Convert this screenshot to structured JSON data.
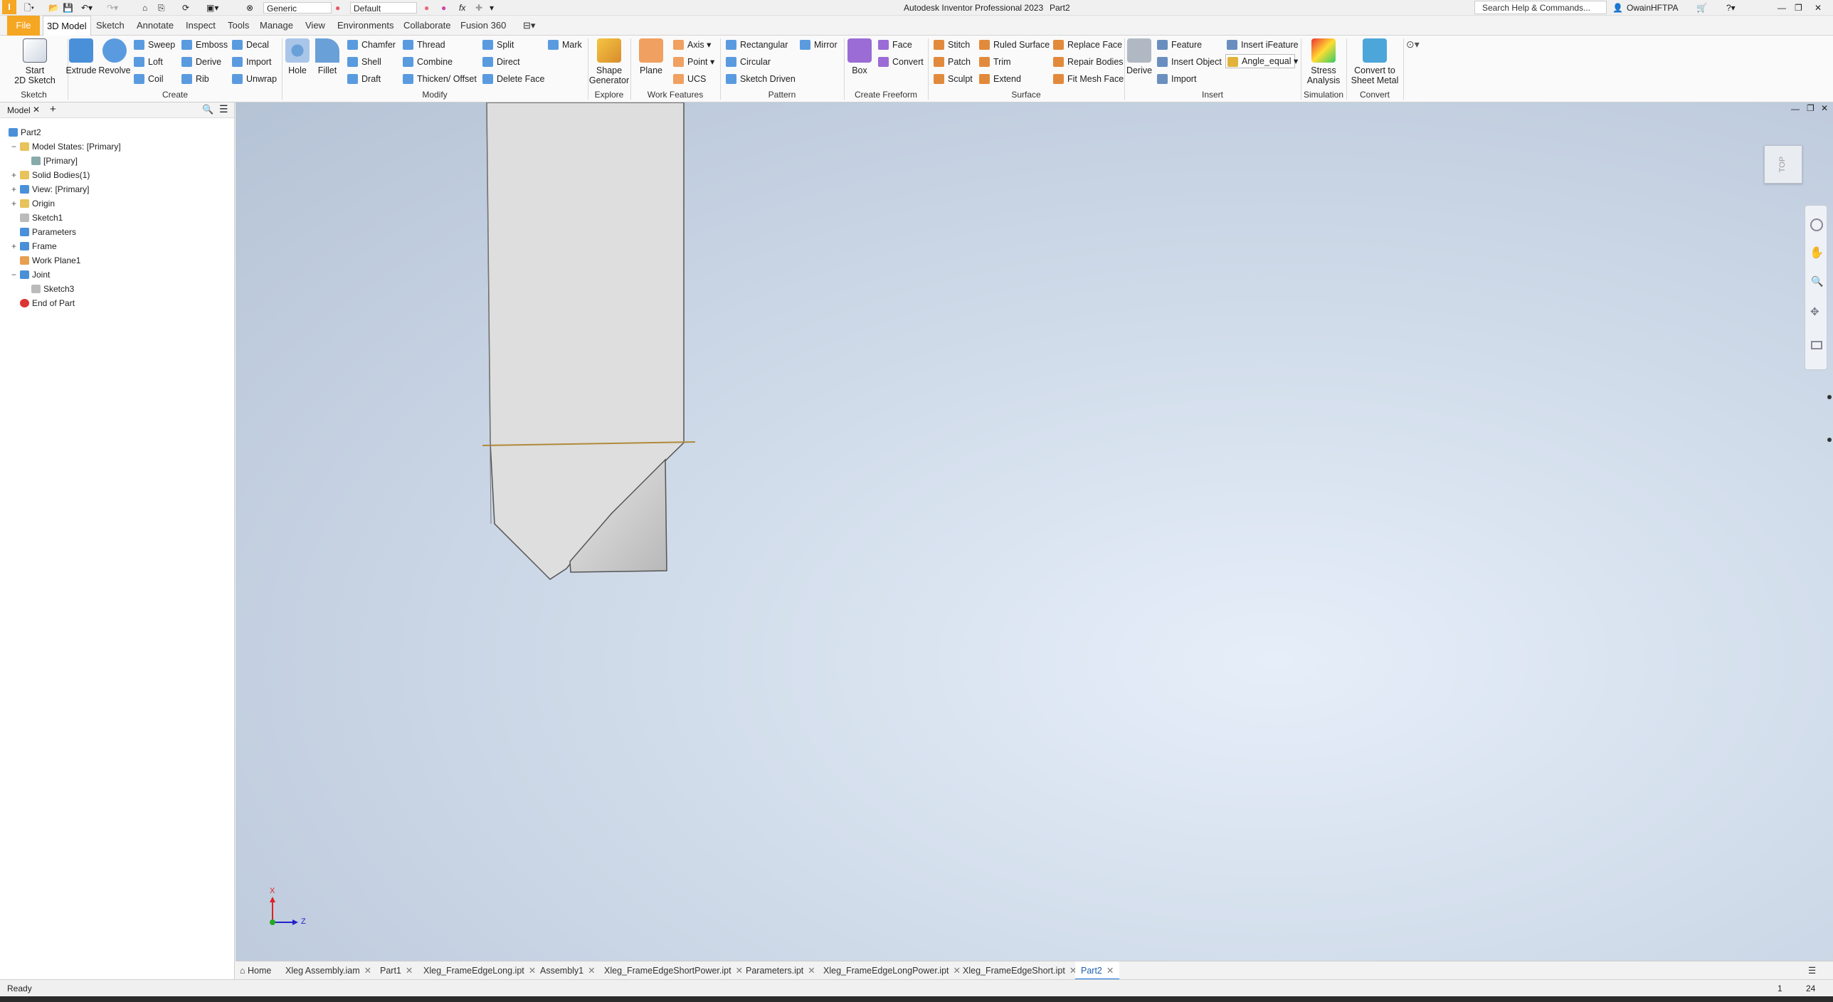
{
  "app": {
    "title": "Autodesk Inventor Professional 2023",
    "doc": "Part2"
  },
  "quick_access": {
    "appearance": "Generic",
    "material": "Default",
    "fx": "fx"
  },
  "search": {
    "placeholder": "Search Help & Commands..."
  },
  "user": {
    "name": "OwainHFTPA"
  },
  "tabs": [
    "File",
    "3D Model",
    "Sketch",
    "Annotate",
    "Inspect",
    "Tools",
    "Manage",
    "View",
    "Environments",
    "Collaborate",
    "Fusion 360"
  ],
  "ribbon": {
    "sketch": {
      "start_line1": "Start",
      "start_line2": "2D Sketch",
      "label": "Sketch"
    },
    "create": {
      "extrude": "Extrude",
      "revolve": "Revolve",
      "sweep": "Sweep",
      "loft": "Loft",
      "coil": "Coil",
      "emboss": "Emboss",
      "derive": "Derive",
      "rib": "Rib",
      "decal": "Decal",
      "import": "Import",
      "unwrap": "Unwrap",
      "label": "Create"
    },
    "modify": {
      "hole": "Hole",
      "fillet": "Fillet",
      "chamfer": "Chamfer",
      "shell": "Shell",
      "draft": "Draft",
      "thread": "Thread",
      "combine": "Combine",
      "thicken": "Thicken/ Offset",
      "split": "Split",
      "direct": "Direct",
      "delete_face": "Delete Face",
      "mark": "Mark",
      "label": "Modify"
    },
    "explore": {
      "shape1": "Shape",
      "shape2": "Generator",
      "label": "Explore"
    },
    "work": {
      "plane": "Plane",
      "axis": "Axis",
      "point": "Point",
      "ucs": "UCS",
      "label": "Work Features"
    },
    "pattern": {
      "rect": "Rectangular",
      "circ": "Circular",
      "sketch": "Sketch Driven",
      "mirror": "Mirror",
      "label": "Pattern"
    },
    "freeform": {
      "box": "Box",
      "face": "Face",
      "convert": "Convert",
      "label": "Create Freeform"
    },
    "surface": {
      "stitch": "Stitch",
      "patch": "Patch",
      "sculpt": "Sculpt",
      "ruled": "Ruled Surface",
      "trim": "Trim",
      "extend": "Extend",
      "replace": "Replace Face",
      "repair": "Repair Bodies",
      "fitmesh": "Fit Mesh Face",
      "label": "Surface"
    },
    "insert": {
      "derive": "Derive",
      "feature": "Feature",
      "insert_object": "Insert Object",
      "import": "Import",
      "ifeature": "Insert iFeature",
      "angle": "Angle_equal",
      "label": "Insert"
    },
    "simulation": {
      "l1": "Stress",
      "l2": "Analysis",
      "label": "Simulation"
    },
    "convert": {
      "l1": "Convert to",
      "l2": "Sheet Metal",
      "label": "Convert"
    }
  },
  "browser": {
    "tab": "Model",
    "items": [
      {
        "label": "Part2",
        "indent": 0
      },
      {
        "label": "Model States: [Primary]",
        "indent": 1
      },
      {
        "label": "[Primary]",
        "indent": 2
      },
      {
        "label": "Solid Bodies(1)",
        "indent": 1
      },
      {
        "label": "View: [Primary]",
        "indent": 1
      },
      {
        "label": "Origin",
        "indent": 1
      },
      {
        "label": "Sketch1",
        "indent": 1
      },
      {
        "label": "Parameters",
        "indent": 1
      },
      {
        "label": "Frame",
        "indent": 1
      },
      {
        "label": "Work Plane1",
        "indent": 1
      },
      {
        "label": "Joint",
        "indent": 1
      },
      {
        "label": "Sketch3",
        "indent": 2
      },
      {
        "label": "End of Part",
        "indent": 1
      }
    ]
  },
  "viewcube": {
    "face": "TOP"
  },
  "triad": {
    "x": "X",
    "z": "Z"
  },
  "doc_tabs": [
    "Home",
    "Xleg Assembly.iam",
    "Part1",
    "Xleg_FrameEdgeLong.ipt",
    "Assembly1",
    "Xleg_FrameEdgeShortPower.ipt",
    "Parameters.ipt",
    "Xleg_FrameEdgeLongPower.ipt",
    "Xleg_FrameEdgeShort.ipt",
    "Part2"
  ],
  "status": {
    "text": "Ready",
    "n1": "1",
    "n2": "24"
  },
  "colors": {
    "file_tab": "#f5a623",
    "accent": "#1a73e8",
    "viewport_center": "#e6eef9",
    "viewport_edge": "#b5c3d6"
  }
}
